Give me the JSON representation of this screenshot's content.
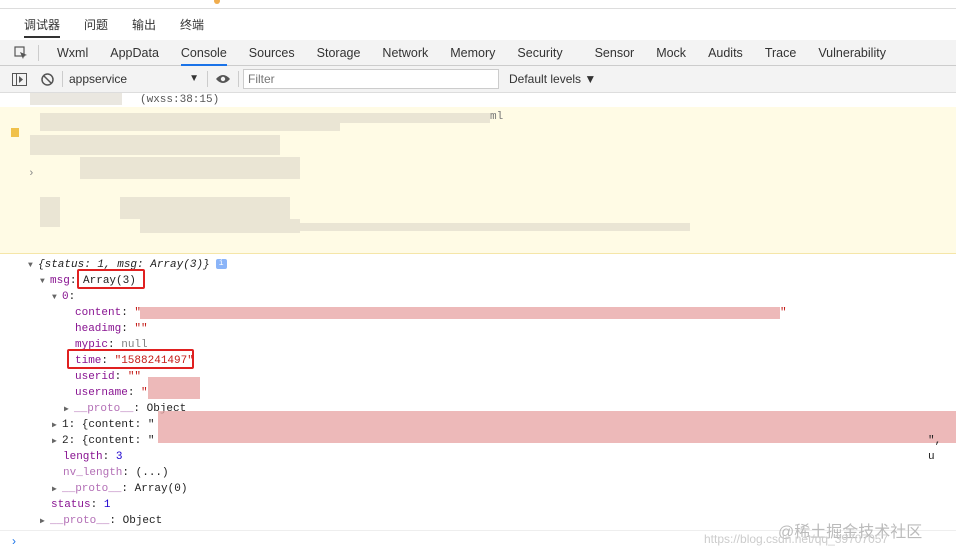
{
  "tabs_top": [
    "调试器",
    "问题",
    "输出",
    "终端"
  ],
  "tabs_main": [
    "Wxml",
    "AppData",
    "Console",
    "Sources",
    "Storage",
    "Network",
    "Memory",
    "Security",
    "Sensor",
    "Mock",
    "Audits",
    "Trace",
    "Vulnerability"
  ],
  "active_main_tab": "Console",
  "toolbar": {
    "context": "appservice",
    "filter_placeholder": "Filter",
    "levels": "Default levels ▼"
  },
  "source_ref": "(wxss:38:15)",
  "warning_tail": "ml",
  "tree": {
    "root": "{status: 1, msg: Array(3)}",
    "msg_key": "msg",
    "msg_val": "Array(3)",
    "item0": "0",
    "content_key": "content",
    "headimg_key": "headimg",
    "headimg_val": "\"\"",
    "mypic_key": "mypic",
    "mypic_val": "null",
    "time_key": "time",
    "time_val": "\"1588241497\"",
    "userid_key": "userid",
    "userid_val": "\"\"",
    "username_key": "username",
    "proto_key": "__proto__",
    "proto_val": "Object",
    "item1": "1: {content: \"",
    "item2": "2: {content: \"",
    "item2_tail": "\", u",
    "length_key": "length",
    "length_val": "3",
    "nvlen_key": "nv_length",
    "nvlen_val": "(...)",
    "aproto_key": "__proto__",
    "aproto_val": "Array(0)",
    "status_key": "status",
    "status_val": "1",
    "oproto_key": "__proto__",
    "oproto_val": "Object"
  },
  "watermark": {
    "main": "@稀土掘金技术社区",
    "sub": "https://blog.csdn.net/qq_39707057"
  },
  "colors": {
    "accent": "#1a73e8",
    "highlight_box": "#e02020",
    "warning_bg": "#fffbe5"
  }
}
